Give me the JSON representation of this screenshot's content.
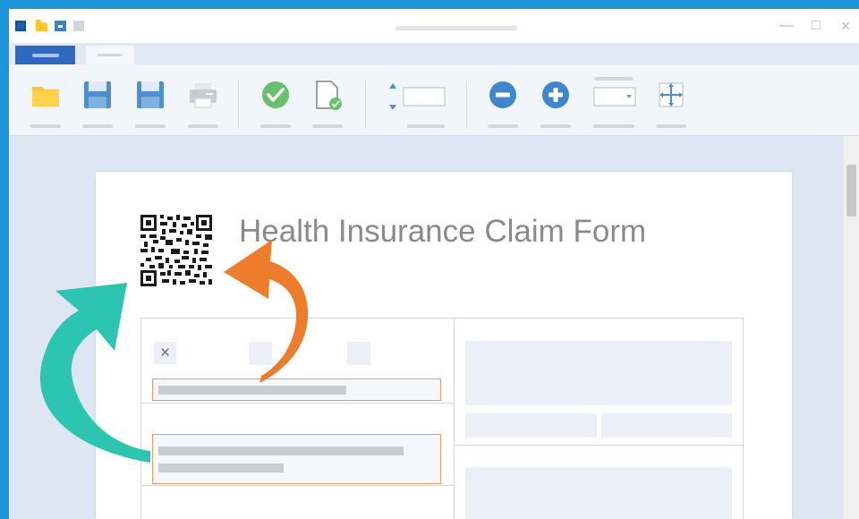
{
  "document": {
    "title": "Health Insurance Claim Form",
    "checkbox_mark": "×"
  },
  "window": {
    "minimize_glyph": "—",
    "maximize_glyph": "□",
    "close_glyph": "×"
  },
  "icons": {
    "ribbon": [
      "open-folder-icon",
      "save-icon",
      "save-as-icon",
      "print-icon",
      "validate-check-icon",
      "document-check-icon",
      "field-height-spinner-icon",
      "zoom-out-icon",
      "zoom-in-icon",
      "dropdown-field-icon",
      "move-icon"
    ],
    "annotations": [
      "teal-curved-arrow-icon",
      "orange-curved-arrow-icon"
    ]
  },
  "colors": {
    "accent_blue": "#2e68bf",
    "desktop_blue": "#1e96dc",
    "highlight_orange": "#eb9d68",
    "arrow_teal": "#2cc5b2",
    "arrow_orange": "#ed7d2a",
    "check_green": "#68c06a",
    "folder_yellow": "#ffc72c"
  }
}
